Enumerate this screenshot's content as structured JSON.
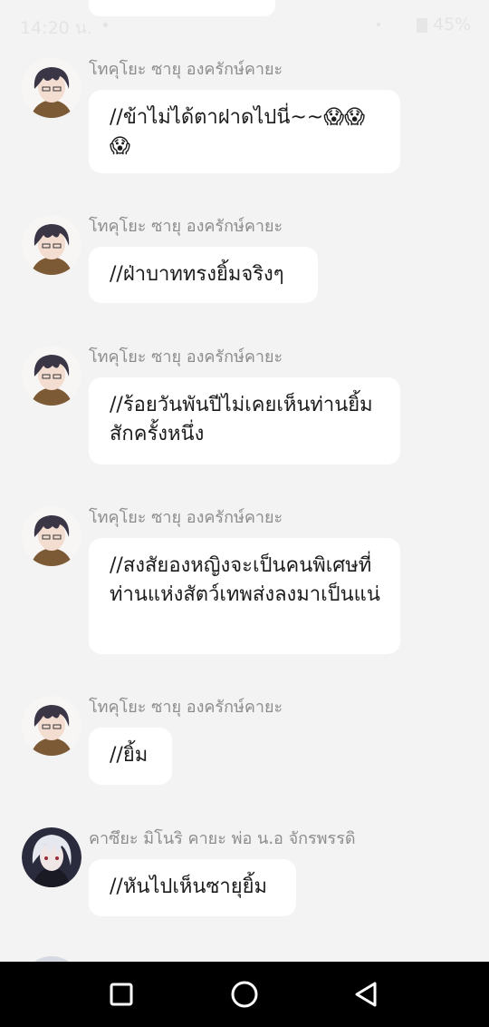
{
  "status_bar": {
    "time": "14:20 น.",
    "battery": "45%"
  },
  "messages": [
    {
      "sender": "โทคุโยะ ซายุ องครักษ์คายะ",
      "text": "//ข้าไม่ได้ตาฝาดไปนี่~~😱😱😱",
      "avatar_icon": "avatar-dark-hair-boy"
    },
    {
      "sender": "โทคุโยะ ซายุ องครักษ์คายะ",
      "text": "//ฝ่าบาททรงยิ้มจริงๆ",
      "avatar_icon": "avatar-dark-hair-boy"
    },
    {
      "sender": "โทคุโยะ ซายุ องครักษ์คายะ",
      "text": "//ร้อยวันพันปีไม่เคยเห็นท่านยิ้มสักครั้งหนึ่ง",
      "avatar_icon": "avatar-dark-hair-boy"
    },
    {
      "sender": "โทคุโยะ ซายุ องครักษ์คายะ",
      "text": "//สงสัยองหญิงจะเป็นคนพิเศษที่ท่านแห่งสัตว์เทพส่งลงมาเป็นแน่",
      "avatar_icon": "avatar-dark-hair-boy"
    },
    {
      "sender": "โทคุโยะ ซายุ องครักษ์คายะ",
      "text": "//ยิ้ม",
      "avatar_icon": "avatar-dark-hair-boy"
    },
    {
      "sender": "คาซึยะ มิโนริ คายะ พ่อ น.อ จักรพรรดิ",
      "text": "//หันไปเห็นซายุยิ้ม",
      "avatar_icon": "avatar-white-hair-man"
    }
  ],
  "nav": {
    "recents_icon": "square-recents-icon",
    "home_icon": "circle-home-icon",
    "back_icon": "triangle-back-icon"
  }
}
